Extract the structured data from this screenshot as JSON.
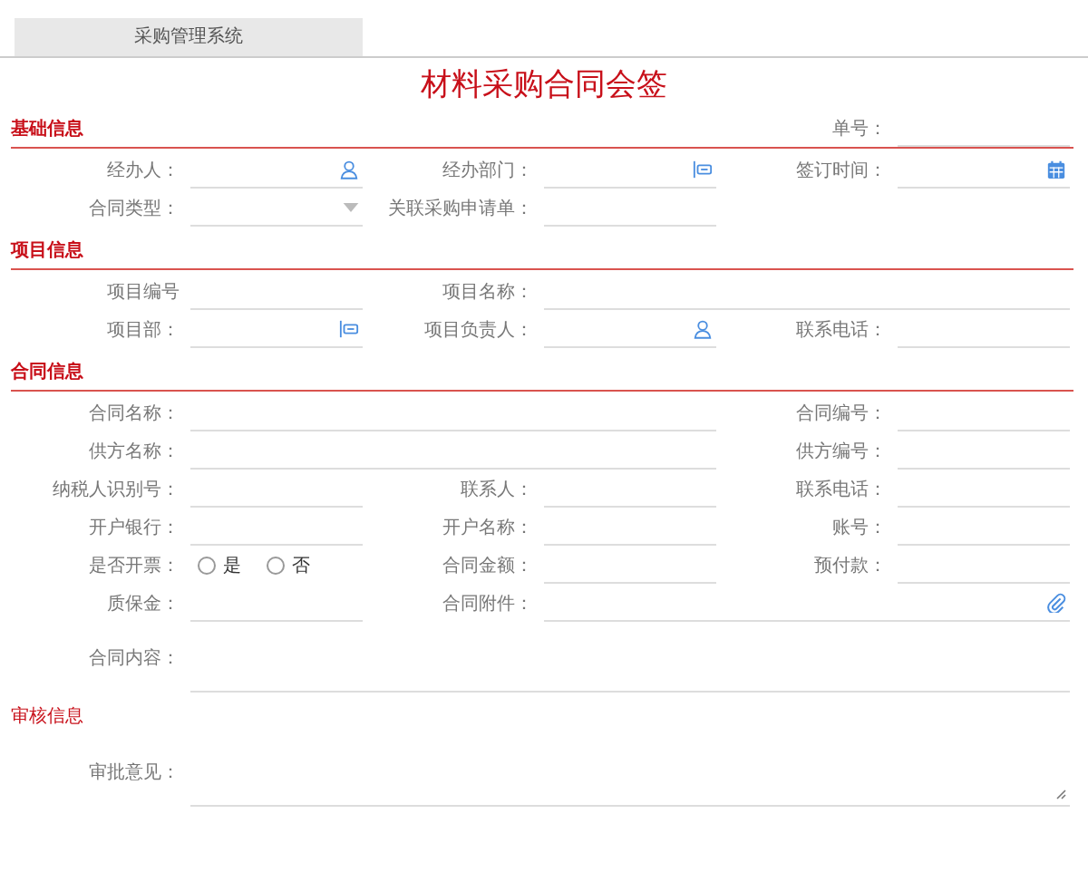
{
  "tab": {
    "label": "采购管理系统",
    "selected": true
  },
  "title": "材料采购合同会签",
  "sections": [
    {
      "title": "基础信息",
      "underline": true,
      "header_field": {
        "label": "单号：",
        "kind": "text"
      },
      "fields": [
        {
          "label": "经办人：",
          "kind": "person"
        },
        {
          "label": "经办部门：",
          "kind": "dept"
        },
        {
          "label": "签订时间：",
          "kind": "date"
        },
        {
          "label": "合同类型：",
          "kind": "select"
        },
        {
          "label": "关联采购申请单：",
          "kind": "text"
        }
      ]
    },
    {
      "title": "项目信息",
      "underline": true,
      "fields": [
        {
          "label": "项目编号",
          "kind": "text"
        },
        {
          "label": "项目名称：",
          "kind": "text",
          "wide": true
        },
        {
          "label": "项目部：",
          "kind": "dept"
        },
        {
          "label": "项目负责人：",
          "kind": "person"
        },
        {
          "label": "联系电话：",
          "kind": "text"
        }
      ]
    },
    {
      "title": "合同信息",
      "underline": true,
      "fields": [
        {
          "label": "合同名称：",
          "kind": "text",
          "wide": true
        },
        {
          "label": "合同编号：",
          "kind": "text"
        },
        {
          "label": "供方名称：",
          "kind": "text",
          "wide": true
        },
        {
          "label": "供方编号：",
          "kind": "text"
        },
        {
          "label": "纳税人识别号：",
          "kind": "text"
        },
        {
          "label": "联系人：",
          "kind": "text"
        },
        {
          "label": "联系电话：",
          "kind": "text"
        },
        {
          "label": "开户银行：",
          "kind": "text"
        },
        {
          "label": "开户名称：",
          "kind": "text"
        },
        {
          "label": "账号：",
          "kind": "text"
        },
        {
          "label": "是否开票：",
          "kind": "radio",
          "options": [
            {
              "label": "是",
              "selected": false
            },
            {
              "label": "否",
              "selected": false
            }
          ]
        },
        {
          "label": "合同金额：",
          "kind": "text"
        },
        {
          "label": "预付款：",
          "kind": "text"
        },
        {
          "label": "质保金：",
          "kind": "text"
        },
        {
          "label": "合同附件：",
          "kind": "attach",
          "wide": true
        },
        {
          "label": "合同内容：",
          "kind": "textarea",
          "full_row": true
        }
      ]
    },
    {
      "title": "审核信息",
      "underline": false,
      "fields": [
        {
          "label": "审批意见：",
          "kind": "textarea",
          "full_row": true,
          "resizable": true
        }
      ]
    }
  ]
}
